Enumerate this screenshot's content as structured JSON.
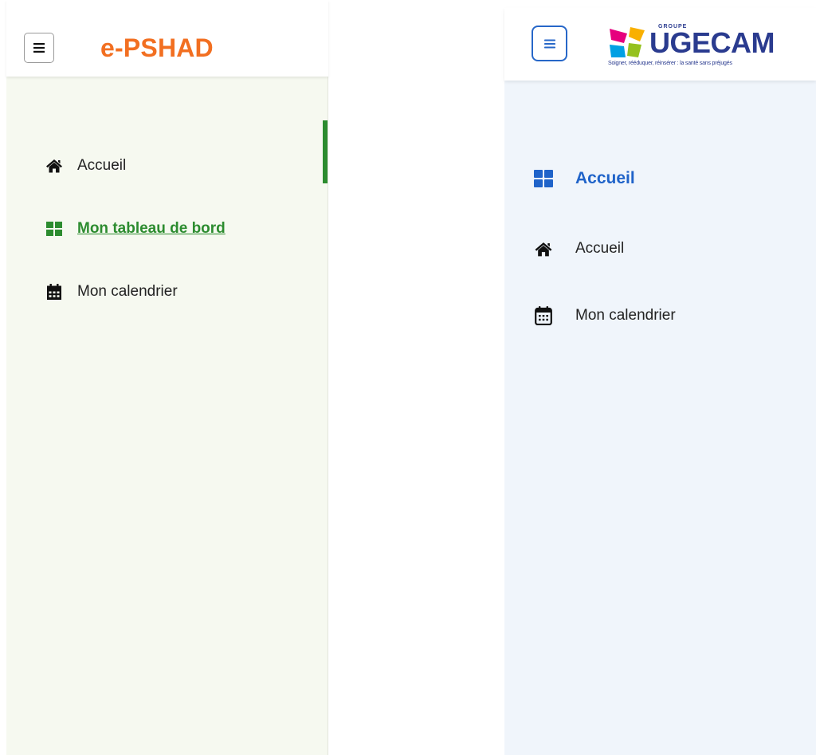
{
  "left": {
    "brand": "e-PSHAD",
    "menu_icon": "hamburger-icon",
    "nav": [
      {
        "label": "Accueil",
        "icon": "home-icon",
        "active": false
      },
      {
        "label": "Mon tableau de bord",
        "icon": "dashboard-grid-icon",
        "active": true
      },
      {
        "label": "Mon calendrier",
        "icon": "calendar-icon",
        "active": false
      }
    ],
    "colors": {
      "brand": "#f26f21",
      "active": "#2c8c2f",
      "sidebar_bg": "#f6f9f0"
    }
  },
  "right": {
    "logo": {
      "groupe": "GROUPE",
      "name": "UGECAM",
      "tagline": "Soigner, rééduquer, réinsérer : la santé sans préjugés"
    },
    "menu_icon": "hamburger-icon",
    "nav": [
      {
        "label": "Accueil",
        "icon": "dashboard-grid-icon",
        "active": true
      },
      {
        "label": "Accueil",
        "icon": "home-icon",
        "active": false
      },
      {
        "label": "Mon calendrier",
        "icon": "calendar-outline-icon",
        "active": false
      }
    ],
    "colors": {
      "accent": "#1f63c9",
      "menu_border": "#2767c8",
      "sidebar_bg": "#f0f5fb",
      "logo_text": "#2a3b8f"
    }
  }
}
